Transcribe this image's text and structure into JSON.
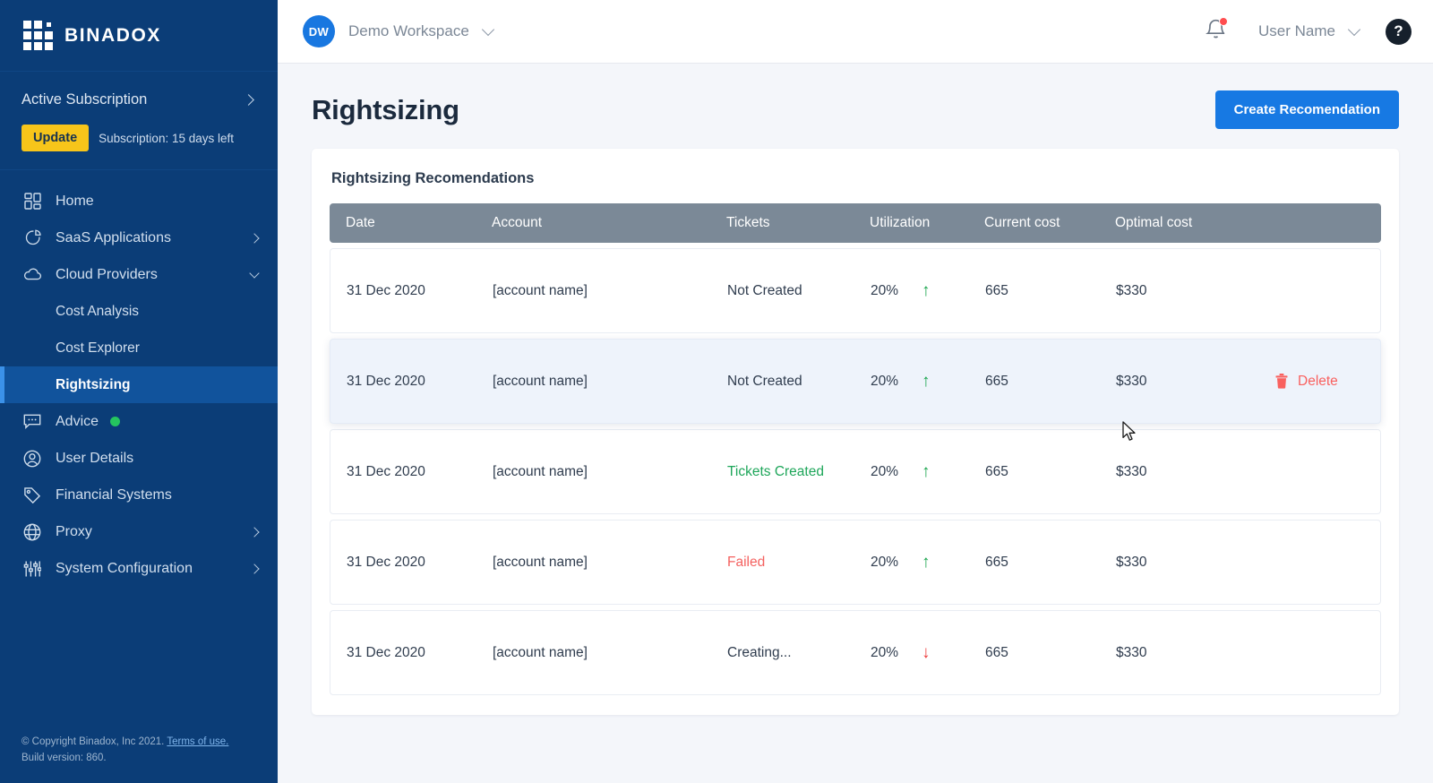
{
  "brand": {
    "name": "BINADOX",
    "logo_icon": "grid-logo-icon"
  },
  "sidebar": {
    "subscription": {
      "title": "Active Subscription",
      "expand_icon": "chevron-right-icon",
      "update_label": "Update",
      "note": "Subscription: 15 days left"
    },
    "items": [
      {
        "label": "Home",
        "icon": "dashboard-grid-icon",
        "expander": "none",
        "active": false
      },
      {
        "label": "SaaS Applications",
        "icon": "pie-chart-icon",
        "expander": "right",
        "active": false
      },
      {
        "label": "Cloud Providers",
        "icon": "cloud-icon",
        "expander": "down",
        "active": false
      },
      {
        "label": "Cost Analysis",
        "icon": "none",
        "expander": "none",
        "active": false,
        "sub": true
      },
      {
        "label": "Cost Explorer",
        "icon": "none",
        "expander": "none",
        "active": false,
        "sub": true
      },
      {
        "label": "Rightsizing",
        "icon": "none",
        "expander": "none",
        "active": true,
        "sub": true
      },
      {
        "label": "Advice",
        "icon": "chat-bubble-icon",
        "expander": "none",
        "active": false,
        "dot": true
      },
      {
        "label": "User Details",
        "icon": "user-circle-icon",
        "expander": "none",
        "active": false
      },
      {
        "label": "Financial Systems",
        "icon": "tag-icon",
        "expander": "none",
        "active": false
      },
      {
        "label": "Proxy",
        "icon": "globe-icon",
        "expander": "right",
        "active": false
      },
      {
        "label": "System Configuration",
        "icon": "sliders-icon",
        "expander": "right",
        "active": false
      }
    ],
    "footer": {
      "copyright": "© Copyright Binadox, Inc 2021.",
      "terms_link": "Terms of use.",
      "build": "Build version: 860."
    }
  },
  "topbar": {
    "workspace_initials": "DW",
    "workspace_name": "Demo Workspace",
    "workspace_chevron_icon": "chevron-down-icon",
    "notifications_icon": "bell-icon",
    "has_notification_badge": true,
    "user_name": "User Name",
    "user_chevron_icon": "chevron-down-icon",
    "help_icon": "question-mark-icon",
    "help_label": "?"
  },
  "page": {
    "title": "Rightsizing",
    "create_button": "Create Recomendation"
  },
  "table": {
    "card_title": "Rightsizing Recomendations",
    "columns": [
      "Date",
      "Account",
      "Tickets",
      "Utilization",
      "Current cost",
      "Optimal cost"
    ],
    "rows": [
      {
        "date": "31 Dec 2020",
        "account": "[account name]",
        "tickets": "Not Created",
        "tickets_status": "plain",
        "utilization": "20%",
        "trend": "up",
        "current_cost": "665",
        "optimal_cost": "$330",
        "highlighted": false,
        "delete_label": ""
      },
      {
        "date": "31 Dec 2020",
        "account": "[account name]",
        "tickets": "Not Created",
        "tickets_status": "plain",
        "utilization": "20%",
        "trend": "up",
        "current_cost": "665",
        "optimal_cost": "$330",
        "highlighted": true,
        "delete_label": "Delete",
        "delete_icon": "trash-icon"
      },
      {
        "date": "31 Dec 2020",
        "account": "[account name]",
        "tickets": "Tickets Created",
        "tickets_status": "green",
        "utilization": "20%",
        "trend": "up",
        "current_cost": "665",
        "optimal_cost": "$330",
        "highlighted": false,
        "delete_label": ""
      },
      {
        "date": "31 Dec 2020",
        "account": "[account name]",
        "tickets": "Failed",
        "tickets_status": "red",
        "utilization": "20%",
        "trend": "up",
        "current_cost": "665",
        "optimal_cost": "$330",
        "highlighted": false,
        "delete_label": ""
      },
      {
        "date": "31 Dec 2020",
        "account": "[account name]",
        "tickets": "Creating...",
        "tickets_status": "plain",
        "utilization": "20%",
        "trend": "down",
        "current_cost": "665",
        "optimal_cost": "$330",
        "highlighted": false,
        "delete_label": ""
      }
    ]
  },
  "colors": {
    "sidebar_bg": "#0b3d77",
    "sidebar_active": "#11539c",
    "accent_blue": "#1779e3",
    "update_yellow": "#f7c51a",
    "table_header_gray": "#7b8997",
    "success_green": "#17a44c",
    "danger_red": "#f4615f",
    "page_bg": "#f4f6fa"
  }
}
